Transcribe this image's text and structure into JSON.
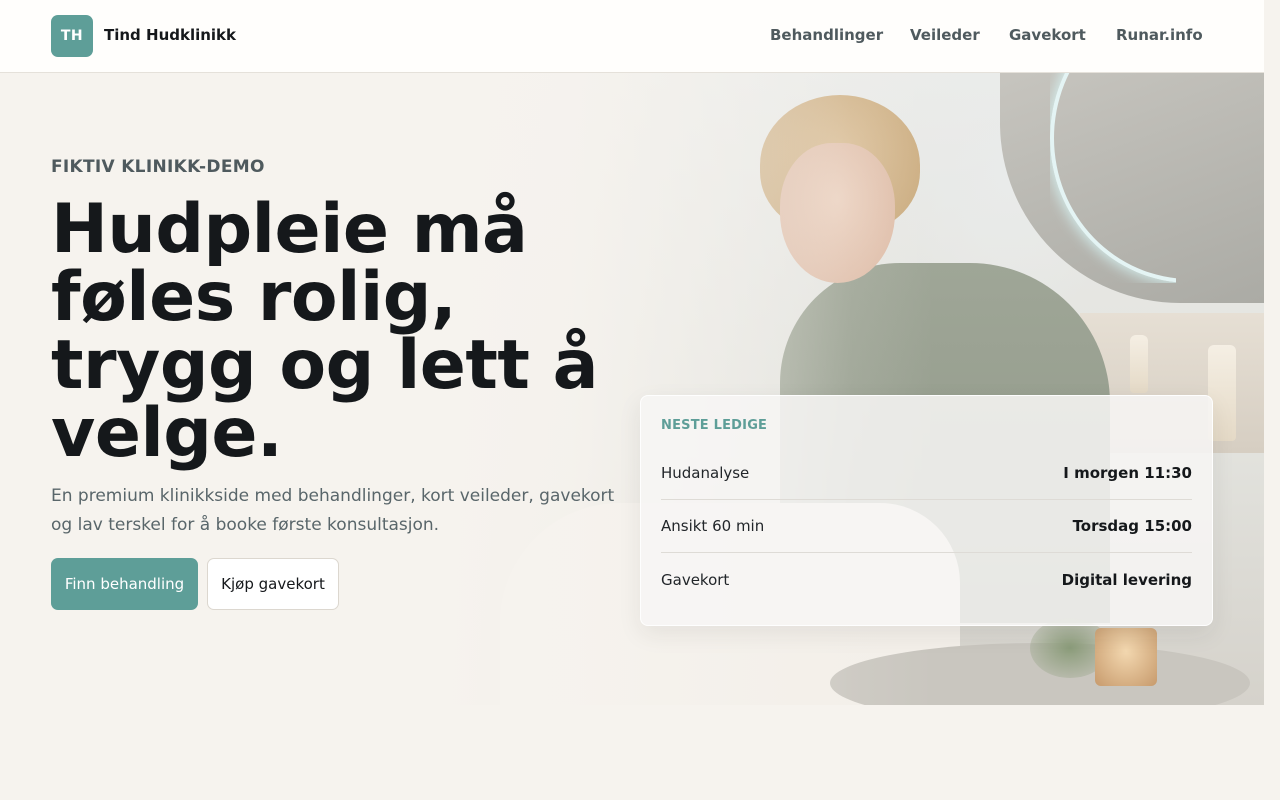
{
  "header": {
    "logo_initials": "TH",
    "brand_name": "Tind Hudklinikk",
    "nav": [
      {
        "label": "Behandlinger"
      },
      {
        "label": "Veileder"
      },
      {
        "label": "Gavekort"
      },
      {
        "label": "Runar.info"
      }
    ]
  },
  "hero": {
    "eyebrow": "FIKTIV KLINIKK-DEMO",
    "headline": "Hudpleie må føles rolig, trygg og lett å velge.",
    "lead": "En premium klinikkside med behandlinger, kort veileder, gavekort og lav terskel for å booke første konsultasjon.",
    "primary_button": "Finn behandling",
    "secondary_button": "Kjøp gavekort"
  },
  "availability": {
    "title": "NESTE LEDIGE",
    "rows": [
      {
        "label": "Hudanalyse",
        "value": "I morgen 11:30"
      },
      {
        "label": "Ansikt 60 min",
        "value": "Torsdag 15:00"
      },
      {
        "label": "Gavekort",
        "value": "Digital levering"
      }
    ]
  },
  "colors": {
    "accent": "#5e9e98",
    "background": "#f6f3ee",
    "text": "#15181b",
    "muted": "#59666a"
  }
}
